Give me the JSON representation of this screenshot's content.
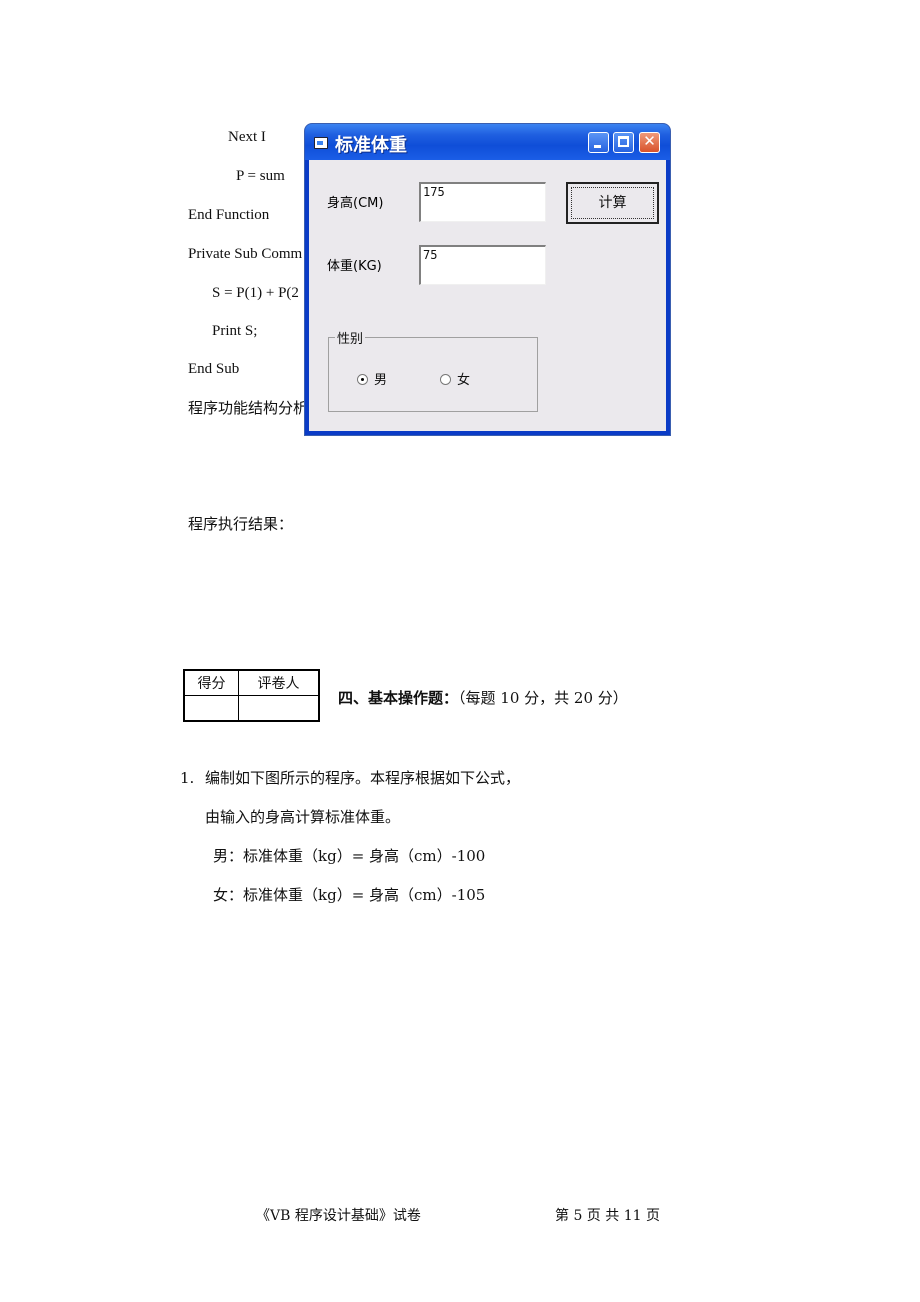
{
  "code_lines": [
    "Next I",
    "P = sum",
    "End Function",
    "Private Sub Comm",
    "S = P(1) + P(2",
    "Print S;",
    "End Sub",
    "程序功能结构分析"
  ],
  "result_label": "程序执行结果：",
  "dialog": {
    "title": "标准体重",
    "height_label": "身高(CM)",
    "height_value": "175",
    "weight_label": "体重(KG)",
    "weight_value": "75",
    "calc_button": "计算",
    "gender_frame": "性别",
    "gender_options": [
      {
        "label": "男",
        "selected": true
      },
      {
        "label": "女",
        "selected": false
      }
    ],
    "buttons": {
      "minimize": "minimize",
      "maximize": "maximize",
      "close": "close"
    }
  },
  "score_table": {
    "headers": [
      "得分",
      "评卷人"
    ],
    "values": [
      "",
      ""
    ]
  },
  "section": {
    "title": "四、基本操作题：",
    "note": "（每题 10 分，共 20 分）"
  },
  "question": {
    "number": "1.",
    "line1": "编制如下图所示的程序。本程序根据如下公式，",
    "line2": "由输入的身高计算标准体重。",
    "formula_male": "男：标准体重（kg）= 身高（cm）-100",
    "formula_female": "女：标准体重（kg）= 身高（cm）-105"
  },
  "footer": {
    "left": "《VB 程序设计基础》试卷",
    "right": "第 5 页 共 11 页"
  }
}
